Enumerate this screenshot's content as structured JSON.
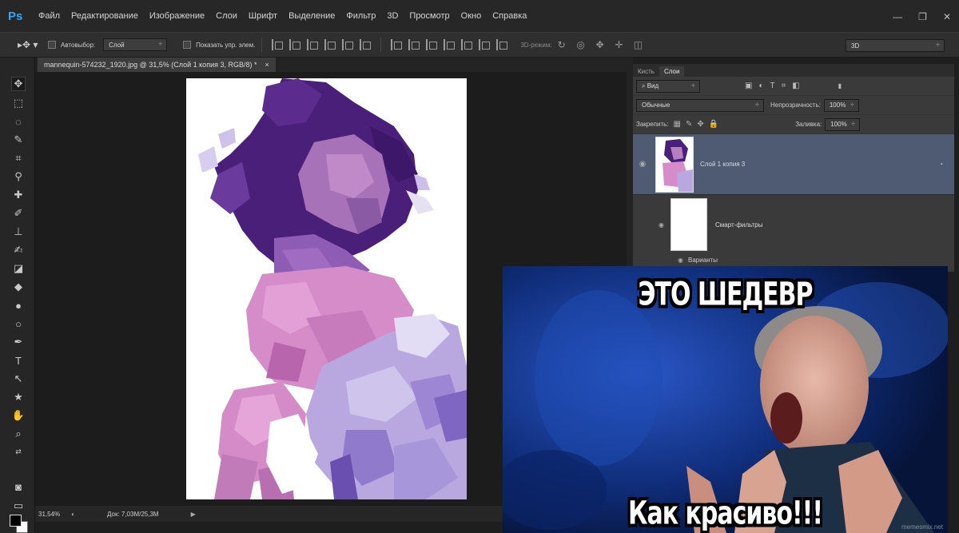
{
  "app": {
    "logo": "Ps",
    "menu": [
      "Файл",
      "Редактирование",
      "Изображение",
      "Слои",
      "Шрифт",
      "Выделение",
      "Фильтр",
      "3D",
      "Просмотр",
      "Окно",
      "Справка"
    ],
    "window_controls": [
      "—",
      "❐",
      "✕"
    ]
  },
  "options": {
    "autoselect_label": "Автовыбор:",
    "autoselect_value": "Слой",
    "show_controls_label": "Показать упр. элем.",
    "mode_3d_label": "3D-режим:",
    "workspace_value": "3D"
  },
  "document": {
    "tab_title": "mannequin-574232_1920.jpg @ 31,5% (Слой 1 копия 3, RGB/8) *",
    "tab_close": "×"
  },
  "status": {
    "zoom": "31,54%",
    "doc_size": "Док: 7,03M/25,3M"
  },
  "layers_panel": {
    "tabs": [
      "Кисть",
      "Слои"
    ],
    "active_tab": "Слои",
    "filter_kind": "Вид",
    "blend_mode": "Обычные",
    "opacity_label": "Непрозрачность:",
    "opacity_value": "100%",
    "lock_label": "Закрепить:",
    "fill_label": "Заливка:",
    "fill_value": "100%",
    "layer_name": "Слой 1 копия 3",
    "smart_filters_label": "Смарт-фильтры",
    "variants_label": "Варианты"
  },
  "meme": {
    "top_text": "ЭТО ШЕДЕВР",
    "bottom_text": "Как красиво!!!",
    "watermark": "memesmix.net"
  },
  "colors": {
    "ps_blue": "#31a8ff",
    "selected_layer": "#4f5a73",
    "dark_purple": "#4a1f7a",
    "mid_purple": "#8e5cb5",
    "pink": "#d58cc9",
    "lavender": "#b9a8e0"
  }
}
